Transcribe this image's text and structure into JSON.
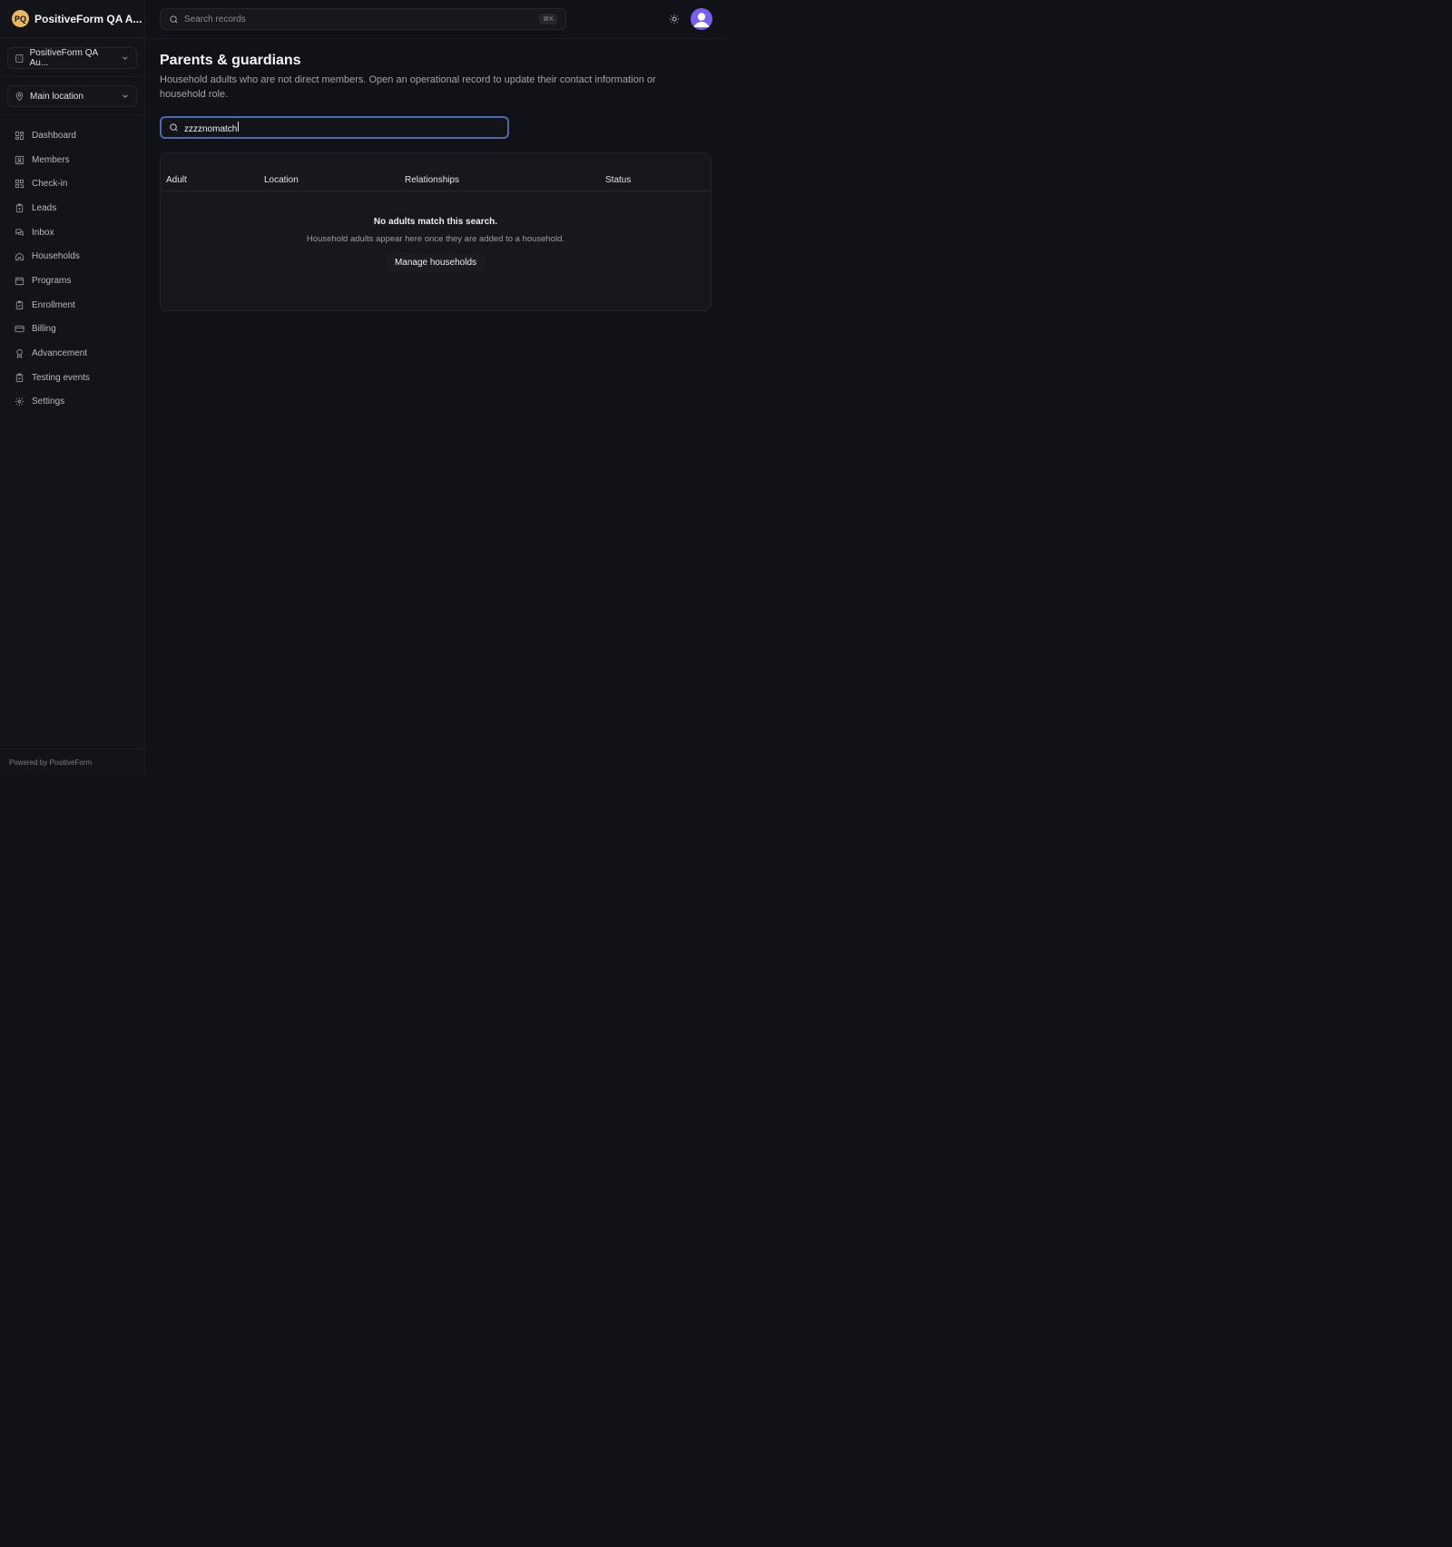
{
  "brand": {
    "initials": "PQ",
    "name": "PositiveForm QA A..."
  },
  "switchers": {
    "organization": "PositiveForm QA Au...",
    "location": "Main location"
  },
  "nav": [
    {
      "label": "Dashboard",
      "icon": "dashboard-icon"
    },
    {
      "label": "Members",
      "icon": "members-icon"
    },
    {
      "label": "Check-in",
      "icon": "check-in-icon"
    },
    {
      "label": "Leads",
      "icon": "clipboard-icon"
    },
    {
      "label": "Inbox",
      "icon": "inbox-icon"
    },
    {
      "label": "Households",
      "icon": "home-icon"
    },
    {
      "label": "Programs",
      "icon": "calendar-icon"
    },
    {
      "label": "Enrollment",
      "icon": "clipboard-check-icon"
    },
    {
      "label": "Billing",
      "icon": "credit-card-icon"
    },
    {
      "label": "Advancement",
      "icon": "award-icon"
    },
    {
      "label": "Testing events",
      "icon": "clipboard-check-icon"
    },
    {
      "label": "Settings",
      "icon": "gear-icon"
    }
  ],
  "footer": {
    "text": "Powered by PositiveForm"
  },
  "topbar": {
    "search_placeholder": "Search records",
    "shortcut": "⌘K"
  },
  "page": {
    "title": "Parents & guardians",
    "description": "Household adults who are not direct members. Open an operational record to update their contact information or household role."
  },
  "filter": {
    "value": "zzzznomatch"
  },
  "table": {
    "columns": [
      "Adult",
      "Location",
      "Relationships",
      "Status"
    ],
    "empty_title": "No adults match this search.",
    "empty_subtitle": "Household adults appear here once they are added to a household.",
    "empty_action": "Manage households"
  },
  "colors": {
    "accent": "#4f6aa8",
    "brand_logo": "#e7b763",
    "avatar": "#7b5cf0",
    "background": "#111217"
  }
}
